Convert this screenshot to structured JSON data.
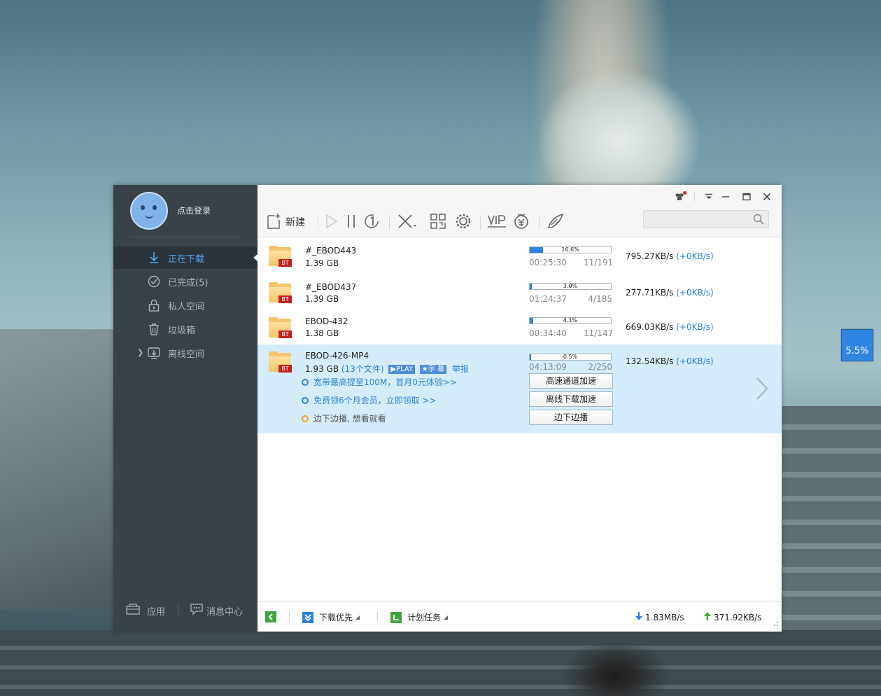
{
  "sidebar": {
    "login_text": "点击登录",
    "nav": [
      {
        "label": "正在下载",
        "icon": "download-arrow-icon",
        "active": true
      },
      {
        "label": "已完成(5)",
        "icon": "check-circle-icon",
        "active": false
      },
      {
        "label": "私人空间",
        "icon": "lock-icon",
        "active": false
      },
      {
        "label": "垃圾箱",
        "icon": "trash-icon",
        "active": false
      },
      {
        "label": "离线空间",
        "icon": "cloud-download-icon",
        "active": false
      }
    ],
    "apps_label": "应用",
    "messages_label": "消息中心"
  },
  "toolbar": {
    "new_label": "新建",
    "search_placeholder": ""
  },
  "tasks": [
    {
      "name": "#_EBOD443",
      "size": "1.39 GB",
      "progress": 16.6,
      "progress_label": "16.6%",
      "time_left": "00:25:30",
      "pieces": "11/191",
      "speed": "795.27KB/s",
      "accel": "(+0KB/s)"
    },
    {
      "name": "#_EBOD437",
      "size": "1.39 GB",
      "progress": 3.0,
      "progress_label": "3.0%",
      "time_left": "01:24:37",
      "pieces": "4/185",
      "speed": "277.71KB/s",
      "accel": "(+0KB/s)"
    },
    {
      "name": "EBOD-432",
      "size": "1.38 GB",
      "progress": 4.1,
      "progress_label": "4.1%",
      "time_left": "00:34:40",
      "pieces": "11/147",
      "speed": "669.03KB/s",
      "accel": "(+0KB/s)"
    },
    {
      "name": "EBOD-426-MP4",
      "size": "1.93 GB",
      "files": "(13个文件)",
      "play_badge": "PLAY",
      "subtitle_badge": "字 幕",
      "report": "举报",
      "progress": 0.5,
      "progress_label": "0.5%",
      "time_left": "04:13:09",
      "pieces": "2/250",
      "speed": "132.54KB/s",
      "accel": "(+0KB/s)",
      "promos": [
        "宽带最高提至100M，首月0元体验>>",
        "免费领6个月会员，立即领取 >>",
        "边下边播, 想看就看"
      ],
      "buttons": [
        "高速通道加速",
        "离线下载加速",
        "边下边播"
      ]
    }
  ],
  "file_badge": "BT",
  "statusbar": {
    "priority_label": "下载优先",
    "schedule_label": "计划任务",
    "down_speed": "1.83MB/s",
    "up_speed": "371.92KB/s"
  },
  "float_monitor": "5.5%",
  "colors": {
    "accent": "#2a86d4",
    "sidebar_bg": "#3a4249",
    "selected_row": "#d5ecfb",
    "progress_fill": "#2d84e0"
  }
}
